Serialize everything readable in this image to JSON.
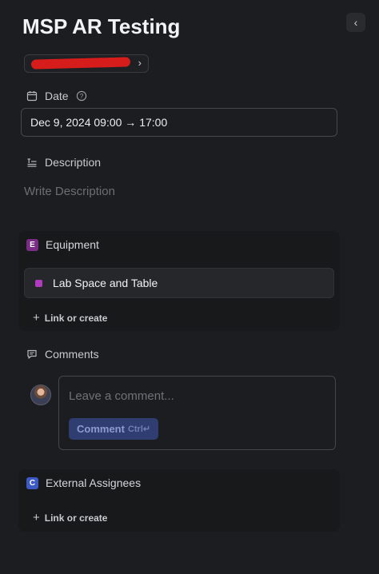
{
  "header": {
    "title": "MSP AR Testing",
    "collapse_icon": "chevron-left-icon"
  },
  "breadcrumb": {
    "chevron_icon": "chevron-right-icon"
  },
  "date": {
    "label": "Date",
    "value": "Dec 9, 2024 09:00 → 17:00",
    "icons": [
      "calendar-icon",
      "help-circle-icon"
    ]
  },
  "description": {
    "label": "Description",
    "placeholder": "Write Description",
    "icon": "description-icon"
  },
  "equipment": {
    "badge": "E",
    "badge_color": "#7b2c86",
    "label": "Equipment",
    "items": [
      {
        "label": "Lab Space and Table",
        "color": "#b13bbf"
      }
    ],
    "link_create": "Link or create"
  },
  "comments": {
    "label": "Comments",
    "icon": "comment-icon",
    "placeholder": "Leave a comment...",
    "button_label": "Comment",
    "button_shortcut": "Ctrl↵"
  },
  "external_assignees": {
    "badge": "C",
    "badge_color": "#3d59c4",
    "label": "External Assignees",
    "link_create": "Link or create"
  }
}
